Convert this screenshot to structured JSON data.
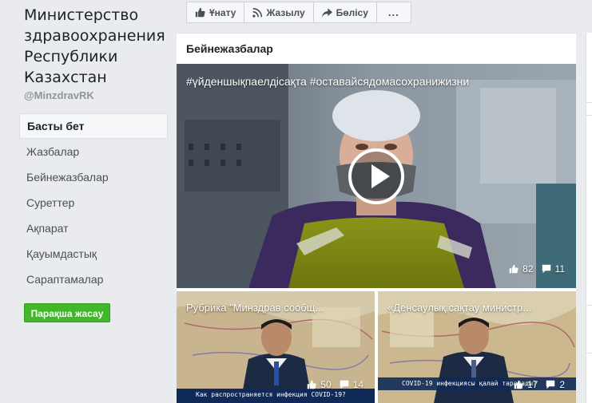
{
  "page": {
    "name": "Министерство здравоохранения Республики Казахстан",
    "handle": "@MinzdravRK"
  },
  "nav": {
    "items": [
      "Басты бет",
      "Жазбалар",
      "Бейнежазбалар",
      "Суреттер",
      "Ақпарат",
      "Қауымдастық",
      "Сараптамалар"
    ],
    "active_index": 0
  },
  "create_page_label": "Парақша жасау",
  "actions": {
    "like_label": "Ұнату",
    "follow_label": "Жазылу",
    "share_label": "Бөлісу",
    "more_label": "..."
  },
  "videos_section": {
    "title": "Бейнежазбалар",
    "main": {
      "title": "#үйденшықпаелдісақта #оставайсядомасохранижизни",
      "likes": "82",
      "comments": "11"
    },
    "small": [
      {
        "title": "Рубрика \"Минздрав сообщ...",
        "likes": "50",
        "comments": "14",
        "caption": "Как распространяется инфекция COVID-19?"
      },
      {
        "title": "«Денсаулық сақтау министр...",
        "likes": "17",
        "comments": "2",
        "caption": "COVID-19 инфекциясы қалай таралады?"
      }
    ]
  },
  "colors": {
    "background": "#e9ebee",
    "create_button": "#42b72a",
    "card": "#ffffff"
  }
}
